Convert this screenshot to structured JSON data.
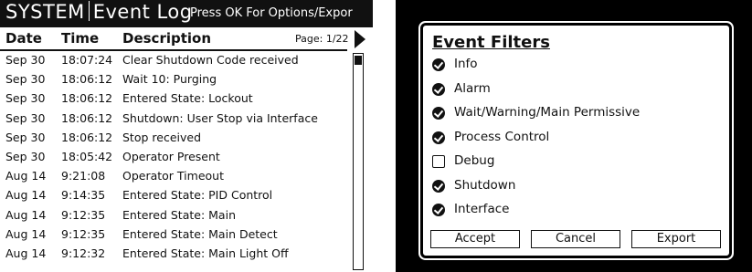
{
  "event_log": {
    "title_system": "SYSTEM",
    "title_name": "Event Log",
    "hint": "Press OK For Options/Expor",
    "columns": {
      "date": "Date",
      "time": "Time",
      "description": "Description"
    },
    "page": "Page: 1/22",
    "rows": [
      {
        "date": "Sep 30",
        "time": "18:07:24",
        "desc": "Clear Shutdown Code received"
      },
      {
        "date": "Sep 30",
        "time": "18:06:12",
        "desc": "Wait 10: Purging"
      },
      {
        "date": "Sep 30",
        "time": "18:06:12",
        "desc": "Entered State: Lockout"
      },
      {
        "date": "Sep 30",
        "time": "18:06:12",
        "desc": "Shutdown: User Stop via Interface"
      },
      {
        "date": "Sep 30",
        "time": "18:06:12",
        "desc": "Stop received"
      },
      {
        "date": "Sep 30",
        "time": "18:05:42",
        "desc": "Operator Present"
      },
      {
        "date": "Aug 14",
        "time": "9:21:08",
        "desc": "Operator Timeout"
      },
      {
        "date": "Aug 14",
        "time": "9:14:35",
        "desc": "Entered State: PID Control"
      },
      {
        "date": "Aug 14",
        "time": "9:12:35",
        "desc": "Entered State: Main"
      },
      {
        "date": "Aug 14",
        "time": "9:12:35",
        "desc": "Entered State: Main Detect"
      },
      {
        "date": "Aug 14",
        "time": "9:12:32",
        "desc": "Entered State: Main Light Off"
      }
    ]
  },
  "event_filters": {
    "title": "Event Filters",
    "options": [
      {
        "label": "Info",
        "checked": true
      },
      {
        "label": "Alarm",
        "checked": true
      },
      {
        "label": "Wait/Warning/Main Permissive",
        "checked": true
      },
      {
        "label": "Process Control",
        "checked": true
      },
      {
        "label": "Debug",
        "checked": false
      },
      {
        "label": "Shutdown",
        "checked": true
      },
      {
        "label": "Interface",
        "checked": true
      }
    ],
    "buttons": {
      "accept": "Accept",
      "cancel": "Cancel",
      "export": "Export"
    }
  }
}
